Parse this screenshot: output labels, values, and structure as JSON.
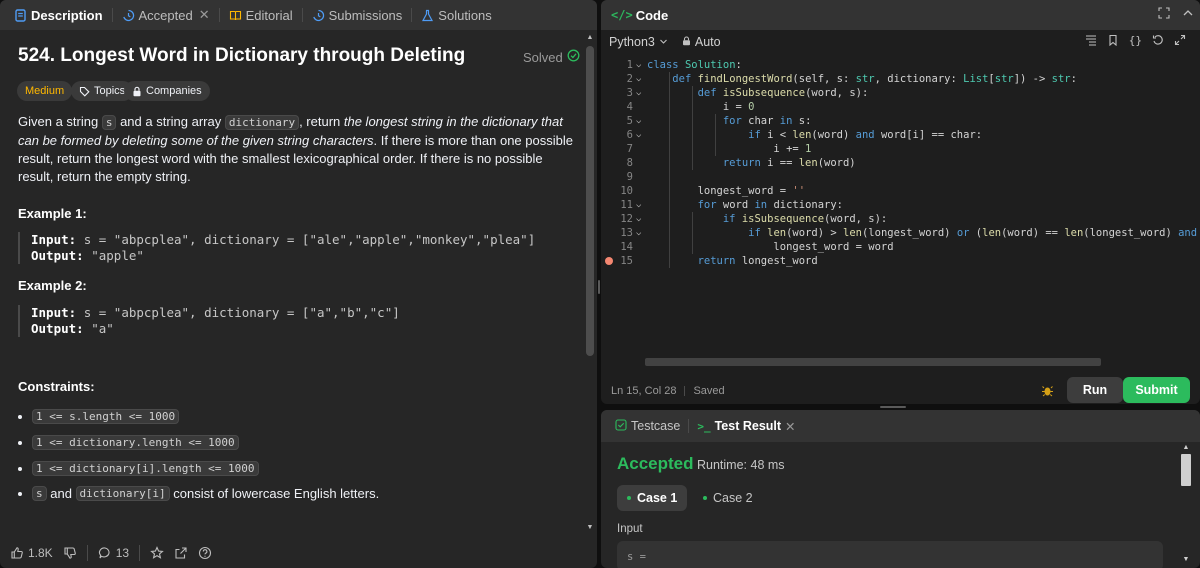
{
  "left_tabs": [
    {
      "label": "Description",
      "icon": "document-icon",
      "active": true
    },
    {
      "label": "Accepted",
      "icon": "history-icon",
      "active": false,
      "closable": true
    },
    {
      "label": "Editorial",
      "icon": "book-icon",
      "active": false
    },
    {
      "label": "Submissions",
      "icon": "history-icon",
      "active": false
    },
    {
      "label": "Solutions",
      "icon": "flask-icon",
      "active": false
    }
  ],
  "problem": {
    "title": "524. Longest Word in Dictionary through Deleting",
    "status": "Solved",
    "difficulty": "Medium",
    "topics_label": "Topics",
    "companies_label": "Companies",
    "desc_p1_a": "Given a string ",
    "desc_p1_code1": "s",
    "desc_p1_b": " and a string array ",
    "desc_p1_code2": "dictionary",
    "desc_p1_c": ", return ",
    "desc_p1_em": "the longest string in the dictionary that can be formed by deleting some of the given string characters",
    "desc_p1_d": ". If there is more than one possible result, return the longest word with the smallest lexicographical order. If there is no possible result, return the empty string.",
    "example1_title": "Example 1:",
    "example1_input_label": "Input:",
    "example1_input": "s = \"abpcplea\", dictionary = [\"ale\",\"apple\",\"monkey\",\"plea\"]",
    "example1_output_label": "Output:",
    "example1_output": "\"apple\"",
    "example2_title": "Example 2:",
    "example2_input_label": "Input:",
    "example2_input": "s = \"abpcplea\", dictionary = [\"a\",\"b\",\"c\"]",
    "example2_output_label": "Output:",
    "example2_output": "\"a\"",
    "constraints_title": "Constraints:",
    "constraints": [
      {
        "code": "1 <= s.length <= 1000",
        "text": ""
      },
      {
        "code": "1 <= dictionary.length <= 1000",
        "text": ""
      },
      {
        "code": "1 <= dictionary[i].length <= 1000",
        "text": ""
      },
      {
        "code_a": "s",
        "mid": " and ",
        "code_b": "dictionary[i]",
        "text": " consist of lowercase English letters."
      }
    ]
  },
  "footer": {
    "likes": "1.8K",
    "comments": "13"
  },
  "code_panel": {
    "title": "Code",
    "language": "Python3",
    "mode": "Auto",
    "cursor": "Ln 15, Col 28",
    "save_state": "Saved",
    "run_label": "Run",
    "submit_label": "Submit",
    "lines": [
      {
        "n": "1",
        "text": "class Solution:"
      },
      {
        "n": "2",
        "text": "    def findLongestWord(self, s: str, dictionary: List[str]) -> str:"
      },
      {
        "n": "3",
        "text": "        def isSubsequence(word, s):"
      },
      {
        "n": "4",
        "text": "            i = 0"
      },
      {
        "n": "5",
        "text": "            for char in s:"
      },
      {
        "n": "6",
        "text": "                if i < len(word) and word[i] == char:"
      },
      {
        "n": "7",
        "text": "                    i += 1"
      },
      {
        "n": "8",
        "text": "            return i == len(word)"
      },
      {
        "n": "9",
        "text": ""
      },
      {
        "n": "10",
        "text": "        longest_word = ''"
      },
      {
        "n": "11",
        "text": "        for word in dictionary:"
      },
      {
        "n": "12",
        "text": "            if isSubsequence(word, s):"
      },
      {
        "n": "13",
        "text": "                if len(word) > len(longest_word) or (len(word) == len(longest_word) and word < lon"
      },
      {
        "n": "14",
        "text": "                    longest_word = word"
      },
      {
        "n": "15",
        "text": "        return longest_word"
      }
    ]
  },
  "result_panel": {
    "tab_testcase": "Testcase",
    "tab_result": "Test Result",
    "verdict": "Accepted",
    "runtime": "Runtime: 48 ms",
    "case1": "Case 1",
    "case2": "Case 2",
    "input_label": "Input",
    "input_value": "s ="
  },
  "colors": {
    "accent_green": "#2cbb5d",
    "medium": "#ffb800",
    "panel_bg": "#262626",
    "editor_bg": "#1e1e1e"
  }
}
